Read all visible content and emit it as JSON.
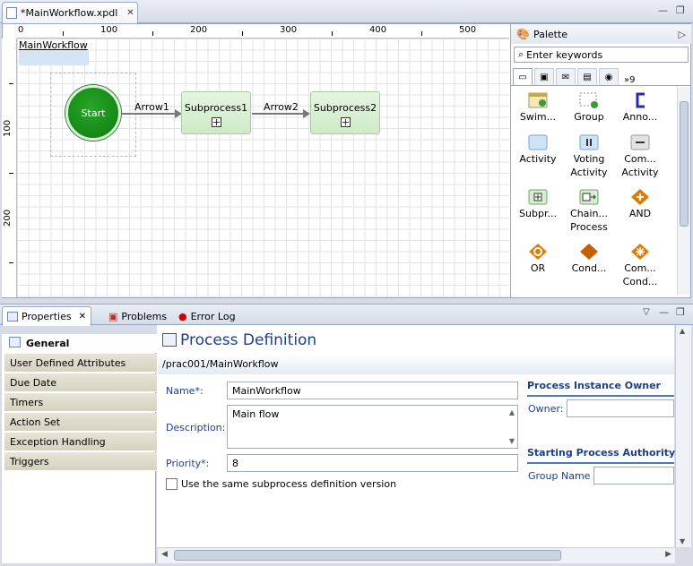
{
  "editor": {
    "tab_title": "*MainWorkflow.xpdl",
    "close_glyph": "✕",
    "min_glyph": "—",
    "max_glyph": "❐"
  },
  "ruler": {
    "top_labels": [
      "0",
      "100",
      "200",
      "300",
      "400",
      "500"
    ],
    "left_labels": [
      "100",
      "200"
    ]
  },
  "diagram": {
    "workflow_name": "MainWorkflow",
    "start_label": "Start",
    "arrow1_label": "Arrow1",
    "arrow2_label": "Arrow2",
    "subprocess1_label": "Subprocess1",
    "subprocess2_label": "Subprocess2"
  },
  "palette": {
    "title": "Palette",
    "search_placeholder": "Enter keywords",
    "tabs_overflow": "»9",
    "items": [
      {
        "label": "Swim...",
        "icon": "swimlane-icon"
      },
      {
        "label": "Group",
        "icon": "group-icon"
      },
      {
        "label": "Anno...",
        "icon": "annotation-icon"
      },
      {
        "label": "Activity",
        "icon": "activity-icon"
      },
      {
        "label": "Voting Activity",
        "icon": "voting-activity-icon"
      },
      {
        "label": "Com... Activity",
        "icon": "compensation-activity-icon"
      },
      {
        "label": "Subpr...",
        "icon": "subprocess-icon"
      },
      {
        "label": "Chain... Process",
        "icon": "chained-process-icon"
      },
      {
        "label": "AND",
        "icon": "and-gateway-icon"
      },
      {
        "label": "OR",
        "icon": "or-gateway-icon"
      },
      {
        "label": "Cond...",
        "icon": "conditional-icon"
      },
      {
        "label": "Com... Cond...",
        "icon": "complex-conditional-icon"
      }
    ]
  },
  "properties_tabs": [
    {
      "label": "Properties",
      "active": true
    },
    {
      "label": "Problems",
      "active": false
    },
    {
      "label": "Error Log",
      "active": false
    }
  ],
  "nav": {
    "items": [
      "General",
      "User Defined Attributes",
      "Due Date",
      "Timers",
      "Action Set",
      "Exception Handling",
      "Triggers"
    ]
  },
  "form": {
    "title": "Process Definition",
    "path": "/prac001/MainWorkflow",
    "name_label": "Name*:",
    "name_value": "MainWorkflow",
    "description_label": "Description:",
    "description_value": "Main flow",
    "priority_label": "Priority*:",
    "priority_value": "8",
    "checkbox_label": "Use the same subprocess definition version",
    "owner_section": "Process Instance Owner",
    "owner_label": "Owner:",
    "authority_section": "Starting Process Authority",
    "group_label": "Group Name"
  },
  "colors": {
    "accent": "#1c3f8a",
    "start_node": "#1a8c1a",
    "subprocess_fill": "#d6eecf",
    "gateway": "#e07b00"
  }
}
